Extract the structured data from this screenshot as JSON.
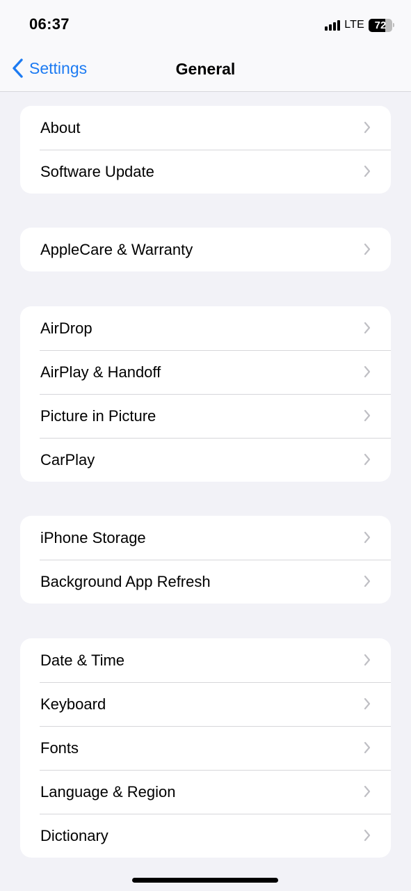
{
  "status_bar": {
    "time": "06:37",
    "network": "LTE",
    "signal_bars": 4,
    "battery_percent": 72,
    "battery_label": "72"
  },
  "nav": {
    "back_label": "Settings",
    "title": "General",
    "accent_color": "#1D7BF2"
  },
  "groups": [
    {
      "items": [
        {
          "label": "About"
        },
        {
          "label": "Software Update"
        }
      ]
    },
    {
      "items": [
        {
          "label": "AppleCare & Warranty"
        }
      ]
    },
    {
      "items": [
        {
          "label": "AirDrop"
        },
        {
          "label": "AirPlay & Handoff"
        },
        {
          "label": "Picture in Picture"
        },
        {
          "label": "CarPlay"
        }
      ]
    },
    {
      "items": [
        {
          "label": "iPhone Storage"
        },
        {
          "label": "Background App Refresh"
        }
      ]
    },
    {
      "items": [
        {
          "label": "Date & Time"
        },
        {
          "label": "Keyboard"
        },
        {
          "label": "Fonts"
        },
        {
          "label": "Language & Region"
        },
        {
          "label": "Dictionary"
        }
      ]
    }
  ],
  "icons": {
    "back": "chevron-left-icon",
    "row_disclosure": "chevron-right-icon"
  }
}
